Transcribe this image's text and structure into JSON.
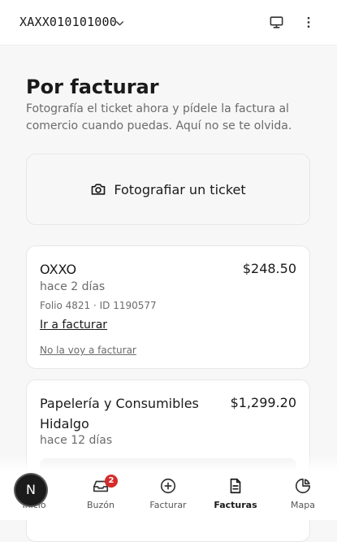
{
  "topbar": {
    "rfc": "XAXX010101000",
    "icons": [
      "chevron-down-icon",
      "monitor-icon",
      "more-vertical-icon"
    ]
  },
  "header": {
    "title": "Por facturar",
    "subtitle": "Fotografía el ticket ahora y pídele la factura al comercio cuando puedas. Aquí no se te olvida."
  },
  "photo_action": {
    "label": "Fotografiar un ticket",
    "icon": "camera-icon"
  },
  "tickets": [
    {
      "merchant": "OXXO",
      "amount": "$248.50",
      "when": "hace 2 días",
      "folio": "Folio 4821 · ID 1190577",
      "invoice_link": "Ir a facturar",
      "dismiss_link": "No la voy a facturar"
    },
    {
      "merchant": "Papelería y Consumibles Hidalgo",
      "amount": "$1,299.20",
      "when": "hace 12 días"
    }
  ],
  "avatar": {
    "initial": "N"
  },
  "nav": [
    {
      "label": "Inicio",
      "icon": "home-icon",
      "active": false
    },
    {
      "label": "Buzón",
      "icon": "inbox-icon",
      "badge": "2",
      "active": false
    },
    {
      "label": "Facturar",
      "icon": "plus-circle-icon",
      "active": false
    },
    {
      "label": "Facturas",
      "icon": "file-text-icon",
      "active": true
    },
    {
      "label": "Mapa",
      "icon": "pie-chart-icon",
      "active": false
    }
  ],
  "colors": {
    "badge": "#d62b2b",
    "avatar": "#1b1b1b",
    "text": "#1a1a1a",
    "muted": "#6b6b6b"
  }
}
